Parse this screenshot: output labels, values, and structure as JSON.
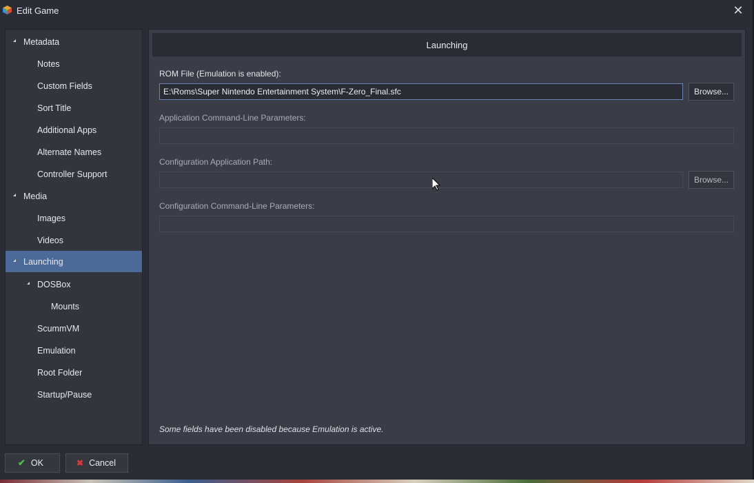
{
  "window": {
    "title": "Edit Game",
    "app_icon": "launchbox-icon",
    "close_icon": "close-icon"
  },
  "sidebar": {
    "items": [
      {
        "label": "Metadata",
        "level": 0,
        "expanded": true,
        "selected": false
      },
      {
        "label": "Notes",
        "level": 1,
        "expanded": false,
        "selected": false
      },
      {
        "label": "Custom Fields",
        "level": 1,
        "expanded": false,
        "selected": false
      },
      {
        "label": "Sort Title",
        "level": 1,
        "expanded": false,
        "selected": false
      },
      {
        "label": "Additional Apps",
        "level": 1,
        "expanded": false,
        "selected": false
      },
      {
        "label": "Alternate Names",
        "level": 1,
        "expanded": false,
        "selected": false
      },
      {
        "label": "Controller Support",
        "level": 1,
        "expanded": false,
        "selected": false
      },
      {
        "label": "Media",
        "level": 0,
        "expanded": true,
        "selected": false
      },
      {
        "label": "Images",
        "level": 1,
        "expanded": false,
        "selected": false
      },
      {
        "label": "Videos",
        "level": 1,
        "expanded": false,
        "selected": false
      },
      {
        "label": "Launching",
        "level": 0,
        "expanded": true,
        "selected": true
      },
      {
        "label": "DOSBox",
        "level": 1,
        "expanded": true,
        "selected": false
      },
      {
        "label": "Mounts",
        "level": 2,
        "expanded": false,
        "selected": false
      },
      {
        "label": "ScummVM",
        "level": 1,
        "expanded": false,
        "selected": false
      },
      {
        "label": "Emulation",
        "level": 1,
        "expanded": false,
        "selected": false
      },
      {
        "label": "Root Folder",
        "level": 1,
        "expanded": false,
        "selected": false
      },
      {
        "label": "Startup/Pause",
        "level": 1,
        "expanded": false,
        "selected": false
      }
    ]
  },
  "panel": {
    "header": "Launching",
    "rom_file": {
      "label": "ROM File (Emulation is enabled):",
      "value": "E:\\Roms\\Super Nintendo Entertainment System\\F-Zero_Final.sfc",
      "browse_label": "Browse..."
    },
    "app_params": {
      "label": "Application Command-Line Parameters:",
      "value": ""
    },
    "config_path": {
      "label": "Configuration Application Path:",
      "value": "",
      "browse_label": "Browse..."
    },
    "config_params": {
      "label": "Configuration Command-Line Parameters:",
      "value": ""
    },
    "note": "Some fields have been disabled because Emulation is active."
  },
  "footer": {
    "ok_label": "OK",
    "cancel_label": "Cancel",
    "ok_icon": "check-icon",
    "cancel_icon": "x-icon"
  },
  "colors": {
    "background": "#2b2d36",
    "selected": "#4b6a98",
    "panel": "#3a3c47",
    "ok_check": "#4cc24c",
    "cancel_x": "#d83a3a"
  }
}
